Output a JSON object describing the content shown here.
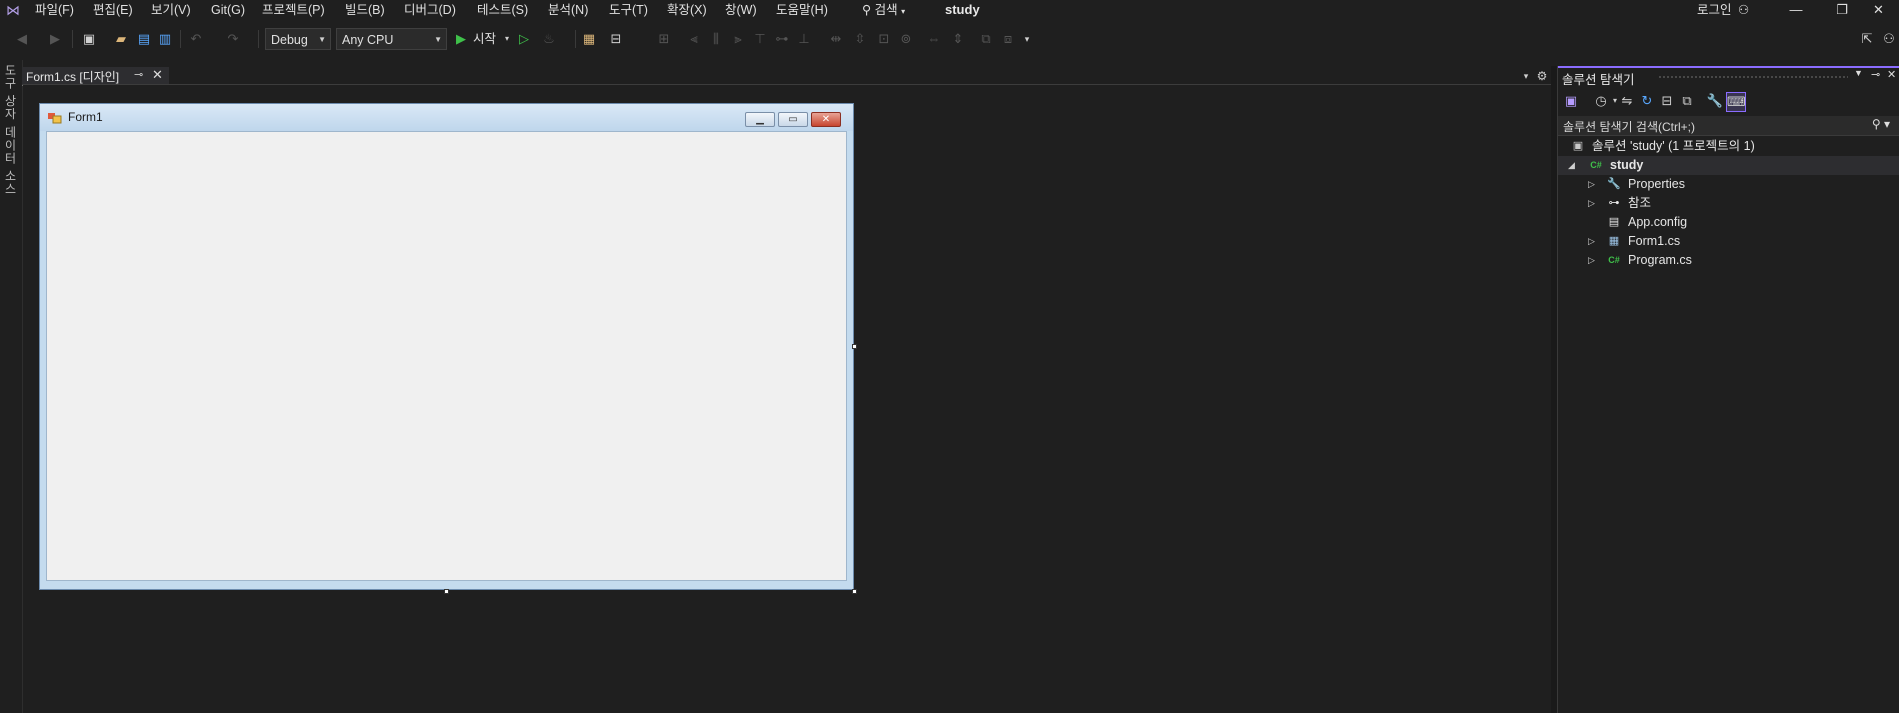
{
  "menubar": {
    "items": [
      "파일(F)",
      "편집(E)",
      "보기(V)",
      "Git(G)",
      "프로젝트(P)",
      "빌드(B)",
      "디버그(D)",
      "테스트(S)",
      "분석(N)",
      "도구(T)",
      "확장(X)",
      "창(W)",
      "도움말(H)"
    ],
    "search_label": "검색",
    "title": "study",
    "login": "로그인"
  },
  "toolbar": {
    "configuration": "Debug",
    "platform": "Any CPU",
    "start_label": "시작"
  },
  "left_strip": {
    "toolbox": "도구 상자",
    "datasource": "데이터 소스"
  },
  "document_tab": {
    "label": "Form1.cs [디자인]"
  },
  "form": {
    "title": "Form1"
  },
  "solution_explorer": {
    "title": "솔루션 탐색기",
    "search_placeholder": "솔루션 탐색기 검색(Ctrl+;)",
    "solution_label": "솔루션 'study' (1 프로젝트의 1)",
    "project": "study",
    "nodes": [
      "Properties",
      "참조",
      "App.config",
      "Form1.cs",
      "Program.cs"
    ]
  },
  "colors": {
    "background": "#1f1f1f",
    "accent": "#8a6cff",
    "form_titlebar": "#c4dbee",
    "form_client": "#f0f0f0",
    "start_green": "#3fc14a"
  }
}
